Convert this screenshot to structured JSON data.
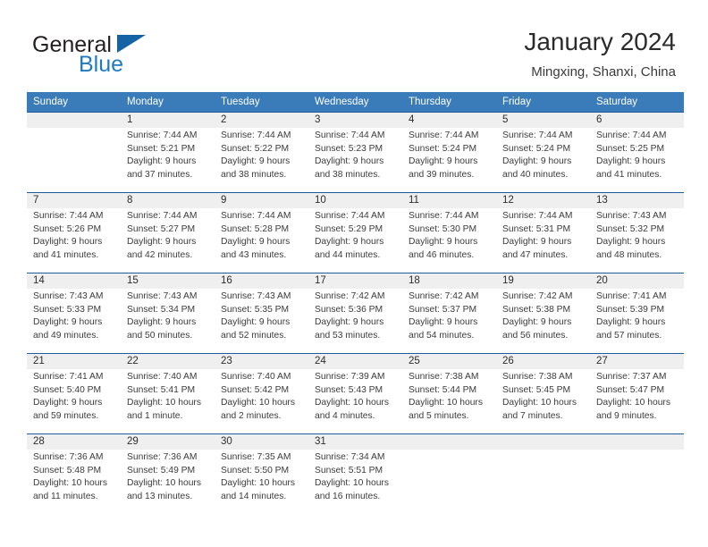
{
  "brand": {
    "word_one": "General",
    "word_two": "Blue"
  },
  "header": {
    "title": "January 2024",
    "subtitle": "Mingxing, Shanxi, China"
  },
  "calendar": {
    "weekdays": [
      "Sunday",
      "Monday",
      "Tuesday",
      "Wednesday",
      "Thursday",
      "Friday",
      "Saturday"
    ],
    "colors": {
      "header_blue": "#3a7cb9",
      "rule_blue": "#1f5c9e",
      "daynum_band": "#efefef",
      "brand_blue": "#1f7bc1",
      "flag_blue": "#1464a5"
    },
    "weeks": [
      [
        {
          "day": "",
          "sunrise": "",
          "sunset": "",
          "daylight_line1": "",
          "daylight_line2": ""
        },
        {
          "day": "1",
          "sunrise": "Sunrise: 7:44 AM",
          "sunset": "Sunset: 5:21 PM",
          "daylight_line1": "Daylight: 9 hours",
          "daylight_line2": "and 37 minutes."
        },
        {
          "day": "2",
          "sunrise": "Sunrise: 7:44 AM",
          "sunset": "Sunset: 5:22 PM",
          "daylight_line1": "Daylight: 9 hours",
          "daylight_line2": "and 38 minutes."
        },
        {
          "day": "3",
          "sunrise": "Sunrise: 7:44 AM",
          "sunset": "Sunset: 5:23 PM",
          "daylight_line1": "Daylight: 9 hours",
          "daylight_line2": "and 38 minutes."
        },
        {
          "day": "4",
          "sunrise": "Sunrise: 7:44 AM",
          "sunset": "Sunset: 5:24 PM",
          "daylight_line1": "Daylight: 9 hours",
          "daylight_line2": "and 39 minutes."
        },
        {
          "day": "5",
          "sunrise": "Sunrise: 7:44 AM",
          "sunset": "Sunset: 5:24 PM",
          "daylight_line1": "Daylight: 9 hours",
          "daylight_line2": "and 40 minutes."
        },
        {
          "day": "6",
          "sunrise": "Sunrise: 7:44 AM",
          "sunset": "Sunset: 5:25 PM",
          "daylight_line1": "Daylight: 9 hours",
          "daylight_line2": "and 41 minutes."
        }
      ],
      [
        {
          "day": "7",
          "sunrise": "Sunrise: 7:44 AM",
          "sunset": "Sunset: 5:26 PM",
          "daylight_line1": "Daylight: 9 hours",
          "daylight_line2": "and 41 minutes."
        },
        {
          "day": "8",
          "sunrise": "Sunrise: 7:44 AM",
          "sunset": "Sunset: 5:27 PM",
          "daylight_line1": "Daylight: 9 hours",
          "daylight_line2": "and 42 minutes."
        },
        {
          "day": "9",
          "sunrise": "Sunrise: 7:44 AM",
          "sunset": "Sunset: 5:28 PM",
          "daylight_line1": "Daylight: 9 hours",
          "daylight_line2": "and 43 minutes."
        },
        {
          "day": "10",
          "sunrise": "Sunrise: 7:44 AM",
          "sunset": "Sunset: 5:29 PM",
          "daylight_line1": "Daylight: 9 hours",
          "daylight_line2": "and 44 minutes."
        },
        {
          "day": "11",
          "sunrise": "Sunrise: 7:44 AM",
          "sunset": "Sunset: 5:30 PM",
          "daylight_line1": "Daylight: 9 hours",
          "daylight_line2": "and 46 minutes."
        },
        {
          "day": "12",
          "sunrise": "Sunrise: 7:44 AM",
          "sunset": "Sunset: 5:31 PM",
          "daylight_line1": "Daylight: 9 hours",
          "daylight_line2": "and 47 minutes."
        },
        {
          "day": "13",
          "sunrise": "Sunrise: 7:43 AM",
          "sunset": "Sunset: 5:32 PM",
          "daylight_line1": "Daylight: 9 hours",
          "daylight_line2": "and 48 minutes."
        }
      ],
      [
        {
          "day": "14",
          "sunrise": "Sunrise: 7:43 AM",
          "sunset": "Sunset: 5:33 PM",
          "daylight_line1": "Daylight: 9 hours",
          "daylight_line2": "and 49 minutes."
        },
        {
          "day": "15",
          "sunrise": "Sunrise: 7:43 AM",
          "sunset": "Sunset: 5:34 PM",
          "daylight_line1": "Daylight: 9 hours",
          "daylight_line2": "and 50 minutes."
        },
        {
          "day": "16",
          "sunrise": "Sunrise: 7:43 AM",
          "sunset": "Sunset: 5:35 PM",
          "daylight_line1": "Daylight: 9 hours",
          "daylight_line2": "and 52 minutes."
        },
        {
          "day": "17",
          "sunrise": "Sunrise: 7:42 AM",
          "sunset": "Sunset: 5:36 PM",
          "daylight_line1": "Daylight: 9 hours",
          "daylight_line2": "and 53 minutes."
        },
        {
          "day": "18",
          "sunrise": "Sunrise: 7:42 AM",
          "sunset": "Sunset: 5:37 PM",
          "daylight_line1": "Daylight: 9 hours",
          "daylight_line2": "and 54 minutes."
        },
        {
          "day": "19",
          "sunrise": "Sunrise: 7:42 AM",
          "sunset": "Sunset: 5:38 PM",
          "daylight_line1": "Daylight: 9 hours",
          "daylight_line2": "and 56 minutes."
        },
        {
          "day": "20",
          "sunrise": "Sunrise: 7:41 AM",
          "sunset": "Sunset: 5:39 PM",
          "daylight_line1": "Daylight: 9 hours",
          "daylight_line2": "and 57 minutes."
        }
      ],
      [
        {
          "day": "21",
          "sunrise": "Sunrise: 7:41 AM",
          "sunset": "Sunset: 5:40 PM",
          "daylight_line1": "Daylight: 9 hours",
          "daylight_line2": "and 59 minutes."
        },
        {
          "day": "22",
          "sunrise": "Sunrise: 7:40 AM",
          "sunset": "Sunset: 5:41 PM",
          "daylight_line1": "Daylight: 10 hours",
          "daylight_line2": "and 1 minute."
        },
        {
          "day": "23",
          "sunrise": "Sunrise: 7:40 AM",
          "sunset": "Sunset: 5:42 PM",
          "daylight_line1": "Daylight: 10 hours",
          "daylight_line2": "and 2 minutes."
        },
        {
          "day": "24",
          "sunrise": "Sunrise: 7:39 AM",
          "sunset": "Sunset: 5:43 PM",
          "daylight_line1": "Daylight: 10 hours",
          "daylight_line2": "and 4 minutes."
        },
        {
          "day": "25",
          "sunrise": "Sunrise: 7:38 AM",
          "sunset": "Sunset: 5:44 PM",
          "daylight_line1": "Daylight: 10 hours",
          "daylight_line2": "and 5 minutes."
        },
        {
          "day": "26",
          "sunrise": "Sunrise: 7:38 AM",
          "sunset": "Sunset: 5:45 PM",
          "daylight_line1": "Daylight: 10 hours",
          "daylight_line2": "and 7 minutes."
        },
        {
          "day": "27",
          "sunrise": "Sunrise: 7:37 AM",
          "sunset": "Sunset: 5:47 PM",
          "daylight_line1": "Daylight: 10 hours",
          "daylight_line2": "and 9 minutes."
        }
      ],
      [
        {
          "day": "28",
          "sunrise": "Sunrise: 7:36 AM",
          "sunset": "Sunset: 5:48 PM",
          "daylight_line1": "Daylight: 10 hours",
          "daylight_line2": "and 11 minutes."
        },
        {
          "day": "29",
          "sunrise": "Sunrise: 7:36 AM",
          "sunset": "Sunset: 5:49 PM",
          "daylight_line1": "Daylight: 10 hours",
          "daylight_line2": "and 13 minutes."
        },
        {
          "day": "30",
          "sunrise": "Sunrise: 7:35 AM",
          "sunset": "Sunset: 5:50 PM",
          "daylight_line1": "Daylight: 10 hours",
          "daylight_line2": "and 14 minutes."
        },
        {
          "day": "31",
          "sunrise": "Sunrise: 7:34 AM",
          "sunset": "Sunset: 5:51 PM",
          "daylight_line1": "Daylight: 10 hours",
          "daylight_line2": "and 16 minutes."
        },
        {
          "day": "",
          "sunrise": "",
          "sunset": "",
          "daylight_line1": "",
          "daylight_line2": ""
        },
        {
          "day": "",
          "sunrise": "",
          "sunset": "",
          "daylight_line1": "",
          "daylight_line2": ""
        },
        {
          "day": "",
          "sunrise": "",
          "sunset": "",
          "daylight_line1": "",
          "daylight_line2": ""
        }
      ]
    ]
  }
}
